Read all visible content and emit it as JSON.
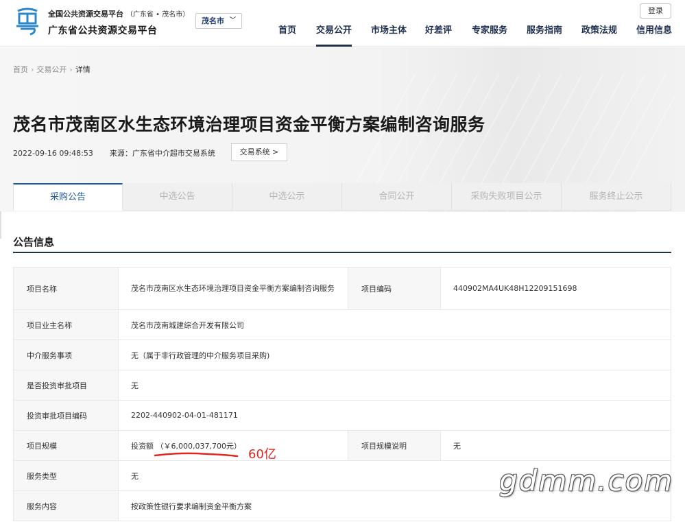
{
  "header": {
    "site_top": "全国公共资源交易平台",
    "site_region": "（广东省 • 茂名市）",
    "site_main": "广东省公共资源交易平台",
    "city_select": "茂名市",
    "login": "登录",
    "nav": [
      {
        "label": "首页"
      },
      {
        "label": "交易公开"
      },
      {
        "label": "市场主体"
      },
      {
        "label": "好差评"
      },
      {
        "label": "专家服务"
      },
      {
        "label": "服务指南"
      },
      {
        "label": "政策法规"
      },
      {
        "label": "信用信息"
      }
    ],
    "nav_active": "交易公开",
    "brand_color": "#1f2f4f",
    "logo_color": "#2b87c9"
  },
  "breadcrumb": {
    "home": "首页",
    "sep": "›",
    "section": "交易公开",
    "current": "详情"
  },
  "page": {
    "title": "茂名市茂南区水生态环境治理项目资金平衡方案编制咨询服务",
    "datetime": "2022-09-16 09:48:53",
    "source": "来源：广东省中介超市交易系统",
    "trade_button": "交易系统 >"
  },
  "tabs": [
    {
      "label": "采购公告",
      "active": true
    },
    {
      "label": "中选公告",
      "active": false
    },
    {
      "label": "中选公示",
      "active": false
    },
    {
      "label": "合同公开",
      "active": false
    },
    {
      "label": "采购失败项目公示",
      "active": false
    },
    {
      "label": "服务终止公示",
      "active": false
    }
  ],
  "section": {
    "title": "公告信息"
  },
  "info": {
    "project_name_label": "项目名称",
    "project_name": "茂名市茂南区水生态环境治理项目资金平衡方案编制咨询服务",
    "project_code_label": "项目编码",
    "project_code": "440902MA4UK48H12209151698",
    "owner_label": "项目业主名称",
    "owner": "茂名市茂南城建综合开发有限公司",
    "service_item_label": "中介服务事项",
    "service_item": "无（属于非行政管理的中介服务项目采购)",
    "invest_approval_label": "是否投资审批项目",
    "invest_approval": "无",
    "approval_code_label": "投资审批项目编码",
    "approval_code": "2202-440902-04-01-481171",
    "scale_label": "项目规模",
    "scale": "投资额 （￥6,000,037,700元）",
    "scale_note_label": "项目规模说明",
    "scale_note": "无",
    "service_type_label": "服务类型",
    "service_type": "无",
    "service_content_label": "服务内容",
    "service_content": "按政策性银行要求编制资金平衡方案"
  },
  "annotation": {
    "text": "60亿",
    "color": "#e0261f"
  },
  "watermark": {
    "text": "gdmm.com"
  }
}
